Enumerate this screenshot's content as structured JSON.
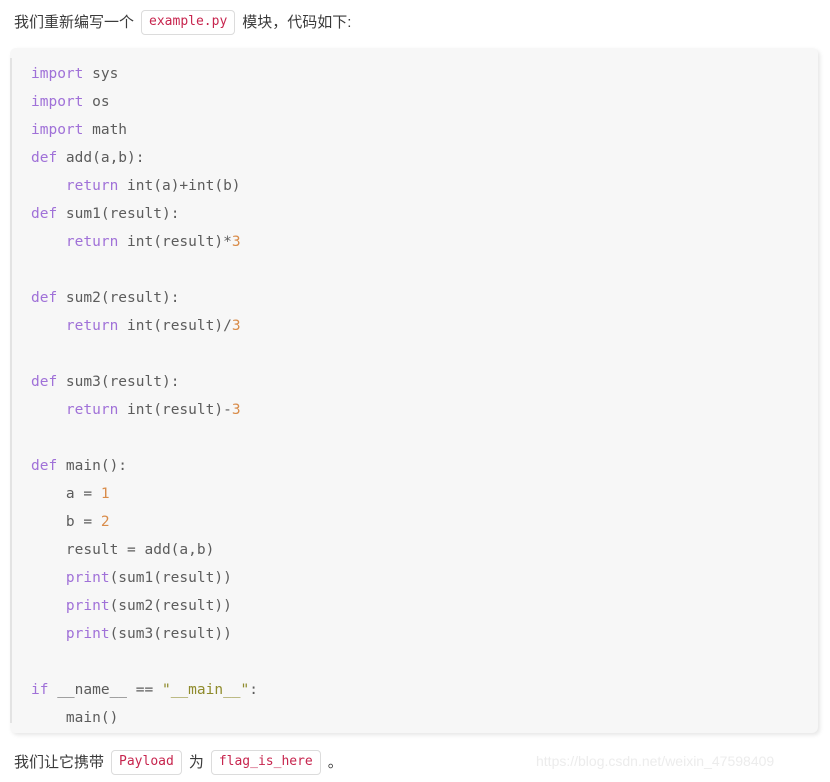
{
  "intro": {
    "text_before": "我们重新编写一个",
    "chip": "example.py",
    "text_after": "模块，代码如下:"
  },
  "code_block": {
    "language": "python",
    "lines": [
      {
        "tokens": [
          {
            "t": "import",
            "c": "k"
          },
          {
            "t": " sys",
            "c": "p"
          }
        ]
      },
      {
        "tokens": [
          {
            "t": "import",
            "c": "k"
          },
          {
            "t": " os",
            "c": "p"
          }
        ]
      },
      {
        "tokens": [
          {
            "t": "import",
            "c": "k"
          },
          {
            "t": " math",
            "c": "p"
          }
        ]
      },
      {
        "tokens": [
          {
            "t": "def",
            "c": "k"
          },
          {
            "t": " add(a,b):",
            "c": "p"
          }
        ]
      },
      {
        "tokens": [
          {
            "t": "    ",
            "c": "p"
          },
          {
            "t": "return",
            "c": "k"
          },
          {
            "t": " int(a)+int(b)",
            "c": "p"
          }
        ]
      },
      {
        "tokens": [
          {
            "t": "def",
            "c": "k"
          },
          {
            "t": " sum1(result):",
            "c": "p"
          }
        ]
      },
      {
        "tokens": [
          {
            "t": "    ",
            "c": "p"
          },
          {
            "t": "return",
            "c": "k"
          },
          {
            "t": " int(result)*",
            "c": "p"
          },
          {
            "t": "3",
            "c": "n"
          }
        ]
      },
      {
        "tokens": []
      },
      {
        "tokens": [
          {
            "t": "def",
            "c": "k"
          },
          {
            "t": " sum2(result):",
            "c": "p"
          }
        ]
      },
      {
        "tokens": [
          {
            "t": "    ",
            "c": "p"
          },
          {
            "t": "return",
            "c": "k"
          },
          {
            "t": " int(result)/",
            "c": "p"
          },
          {
            "t": "3",
            "c": "n"
          }
        ]
      },
      {
        "tokens": []
      },
      {
        "tokens": [
          {
            "t": "def",
            "c": "k"
          },
          {
            "t": " sum3(result):",
            "c": "p"
          }
        ]
      },
      {
        "tokens": [
          {
            "t": "    ",
            "c": "p"
          },
          {
            "t": "return",
            "c": "k"
          },
          {
            "t": " int(result)-",
            "c": "p"
          },
          {
            "t": "3",
            "c": "n"
          }
        ]
      },
      {
        "tokens": []
      },
      {
        "tokens": [
          {
            "t": "def",
            "c": "k"
          },
          {
            "t": " main():",
            "c": "p"
          }
        ]
      },
      {
        "tokens": [
          {
            "t": "    a = ",
            "c": "p"
          },
          {
            "t": "1",
            "c": "n"
          }
        ]
      },
      {
        "tokens": [
          {
            "t": "    b = ",
            "c": "p"
          },
          {
            "t": "2",
            "c": "n"
          }
        ]
      },
      {
        "tokens": [
          {
            "t": "    result = add(a,b)",
            "c": "p"
          }
        ]
      },
      {
        "tokens": [
          {
            "t": "    ",
            "c": "p"
          },
          {
            "t": "print",
            "c": "bi"
          },
          {
            "t": "(sum1(result))",
            "c": "p"
          }
        ]
      },
      {
        "tokens": [
          {
            "t": "    ",
            "c": "p"
          },
          {
            "t": "print",
            "c": "bi"
          },
          {
            "t": "(sum2(result))",
            "c": "p"
          }
        ]
      },
      {
        "tokens": [
          {
            "t": "    ",
            "c": "p"
          },
          {
            "t": "print",
            "c": "bi"
          },
          {
            "t": "(sum3(result))",
            "c": "p"
          }
        ]
      },
      {
        "tokens": []
      },
      {
        "tokens": [
          {
            "t": "if",
            "c": "k"
          },
          {
            "t": " __name__ == ",
            "c": "dn"
          },
          {
            "t": "\"__main__\"",
            "c": "s"
          },
          {
            "t": ":",
            "c": "p"
          }
        ]
      },
      {
        "tokens": [
          {
            "t": "    main()",
            "c": "p"
          }
        ]
      }
    ]
  },
  "outro": {
    "text_before": "我们让它携带",
    "chip_payload": "Payload",
    "text_middle": "为",
    "chip_flag": "flag_is_here",
    "text_after": "。"
  },
  "watermark": {
    "text": "https://blog.csdn.net/weixin_47598409"
  },
  "colors": {
    "keyword": "#a071d8",
    "number": "#d98c4a",
    "string": "#8f8b2c",
    "plain": "#5c5c5c",
    "chip_text": "#c7254e",
    "code_bg": "#f7f7f7",
    "watermark": "#ececec"
  }
}
